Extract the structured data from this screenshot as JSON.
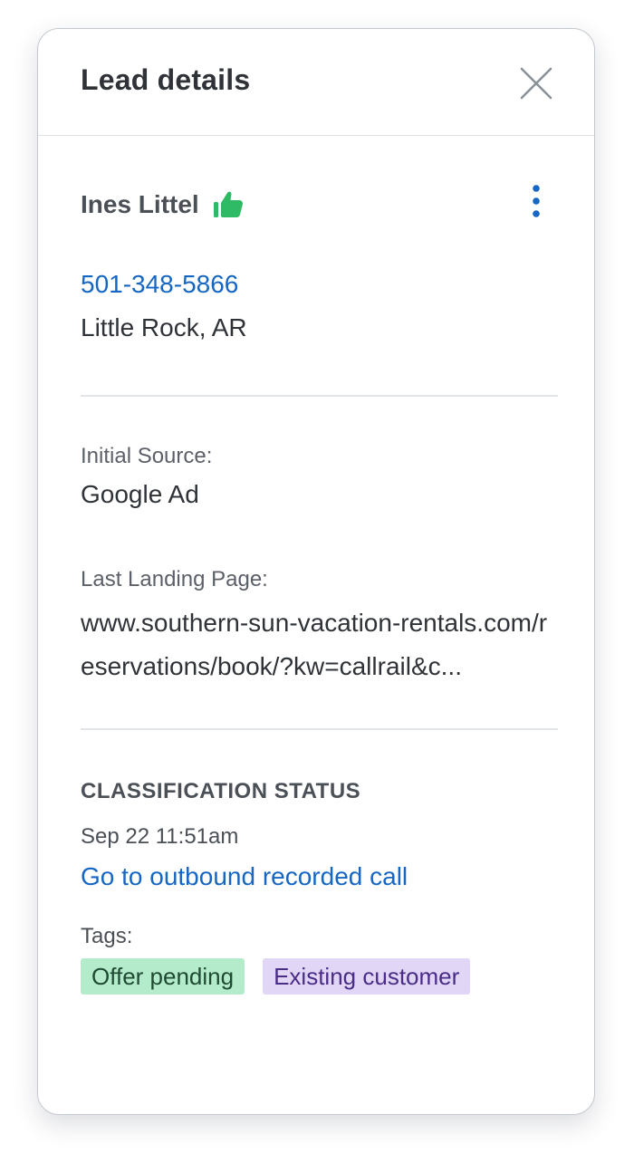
{
  "panel": {
    "title": "Lead details"
  },
  "lead": {
    "name": "Ines Littel",
    "phone": "501-348-5866",
    "location": "Little Rock, AR"
  },
  "source": {
    "initial_source_label": "Initial Source:",
    "initial_source_value": "Google Ad",
    "landing_page_label": "Last Landing Page:",
    "landing_page_value": "www.southern-sun-vacation-rentals.com/reservations/book/?kw=callrail&c..."
  },
  "classification": {
    "section_title": "CLASSIFICATION STATUS",
    "timestamp": "Sep 22 11:51am",
    "call_link": "Go to outbound recorded call",
    "tags_label": "Tags:",
    "tags": [
      {
        "label": "Offer pending"
      },
      {
        "label": "Existing customer"
      }
    ]
  },
  "icons": {
    "close": "close-icon",
    "thumb": "thumbs-up-icon",
    "menu": "more-vertical-icon"
  },
  "colors": {
    "link": "#1667c4",
    "thumb": "#2fba66",
    "tag_green_bg": "#b4eccb",
    "tag_purple_bg": "#e2d6f7"
  }
}
